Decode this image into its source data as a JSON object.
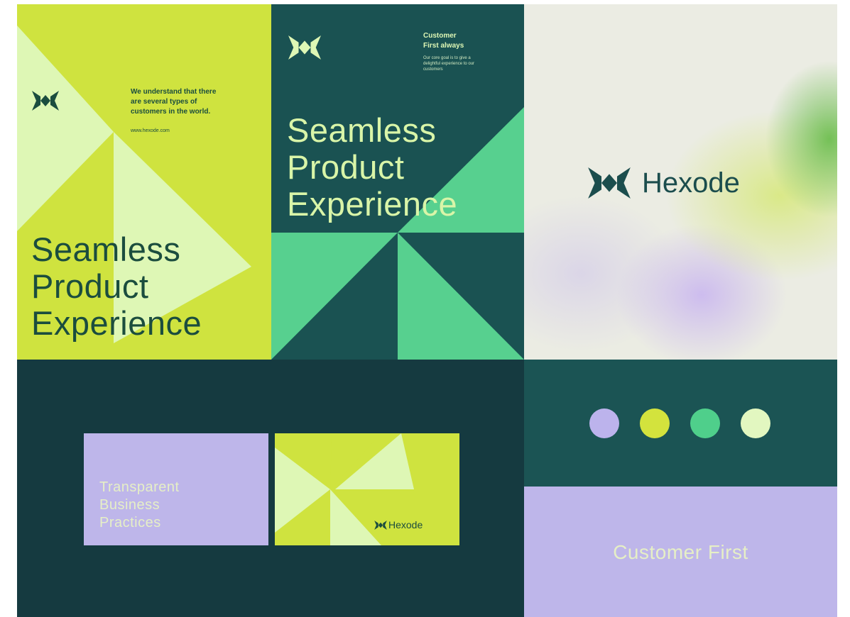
{
  "poster_left": {
    "tagline": [
      "We understand that there",
      "are several types of",
      "customers in the world."
    ],
    "url": "www.hexode.com",
    "headline": [
      "Seamless",
      "Product",
      "Experience"
    ]
  },
  "poster_center": {
    "corner_title": [
      "Customer",
      "First always"
    ],
    "corner_body": [
      "Our core goal is to give a",
      "delightful experience to our",
      "customers"
    ],
    "headline": [
      "Seamless",
      "Product",
      "Experience"
    ]
  },
  "brand_panel": {
    "brand_name": "Hexode"
  },
  "business_cards": {
    "front_text": [
      "Transparent",
      "Business",
      "Practices"
    ],
    "back_brand": "Hexode"
  },
  "palette": {
    "swatches": [
      "#bcb3ec",
      "#d3e33d",
      "#4fcf8b",
      "#e2f7c0"
    ]
  },
  "banner": {
    "text": "Customer First"
  },
  "colors": {
    "yellow_green": "#cfe33f",
    "pale_green": "#def7b5",
    "deep_teal": "#1a5252",
    "mint": "#57d08f",
    "navy": "#153a40",
    "lavender": "#beb6ea"
  }
}
